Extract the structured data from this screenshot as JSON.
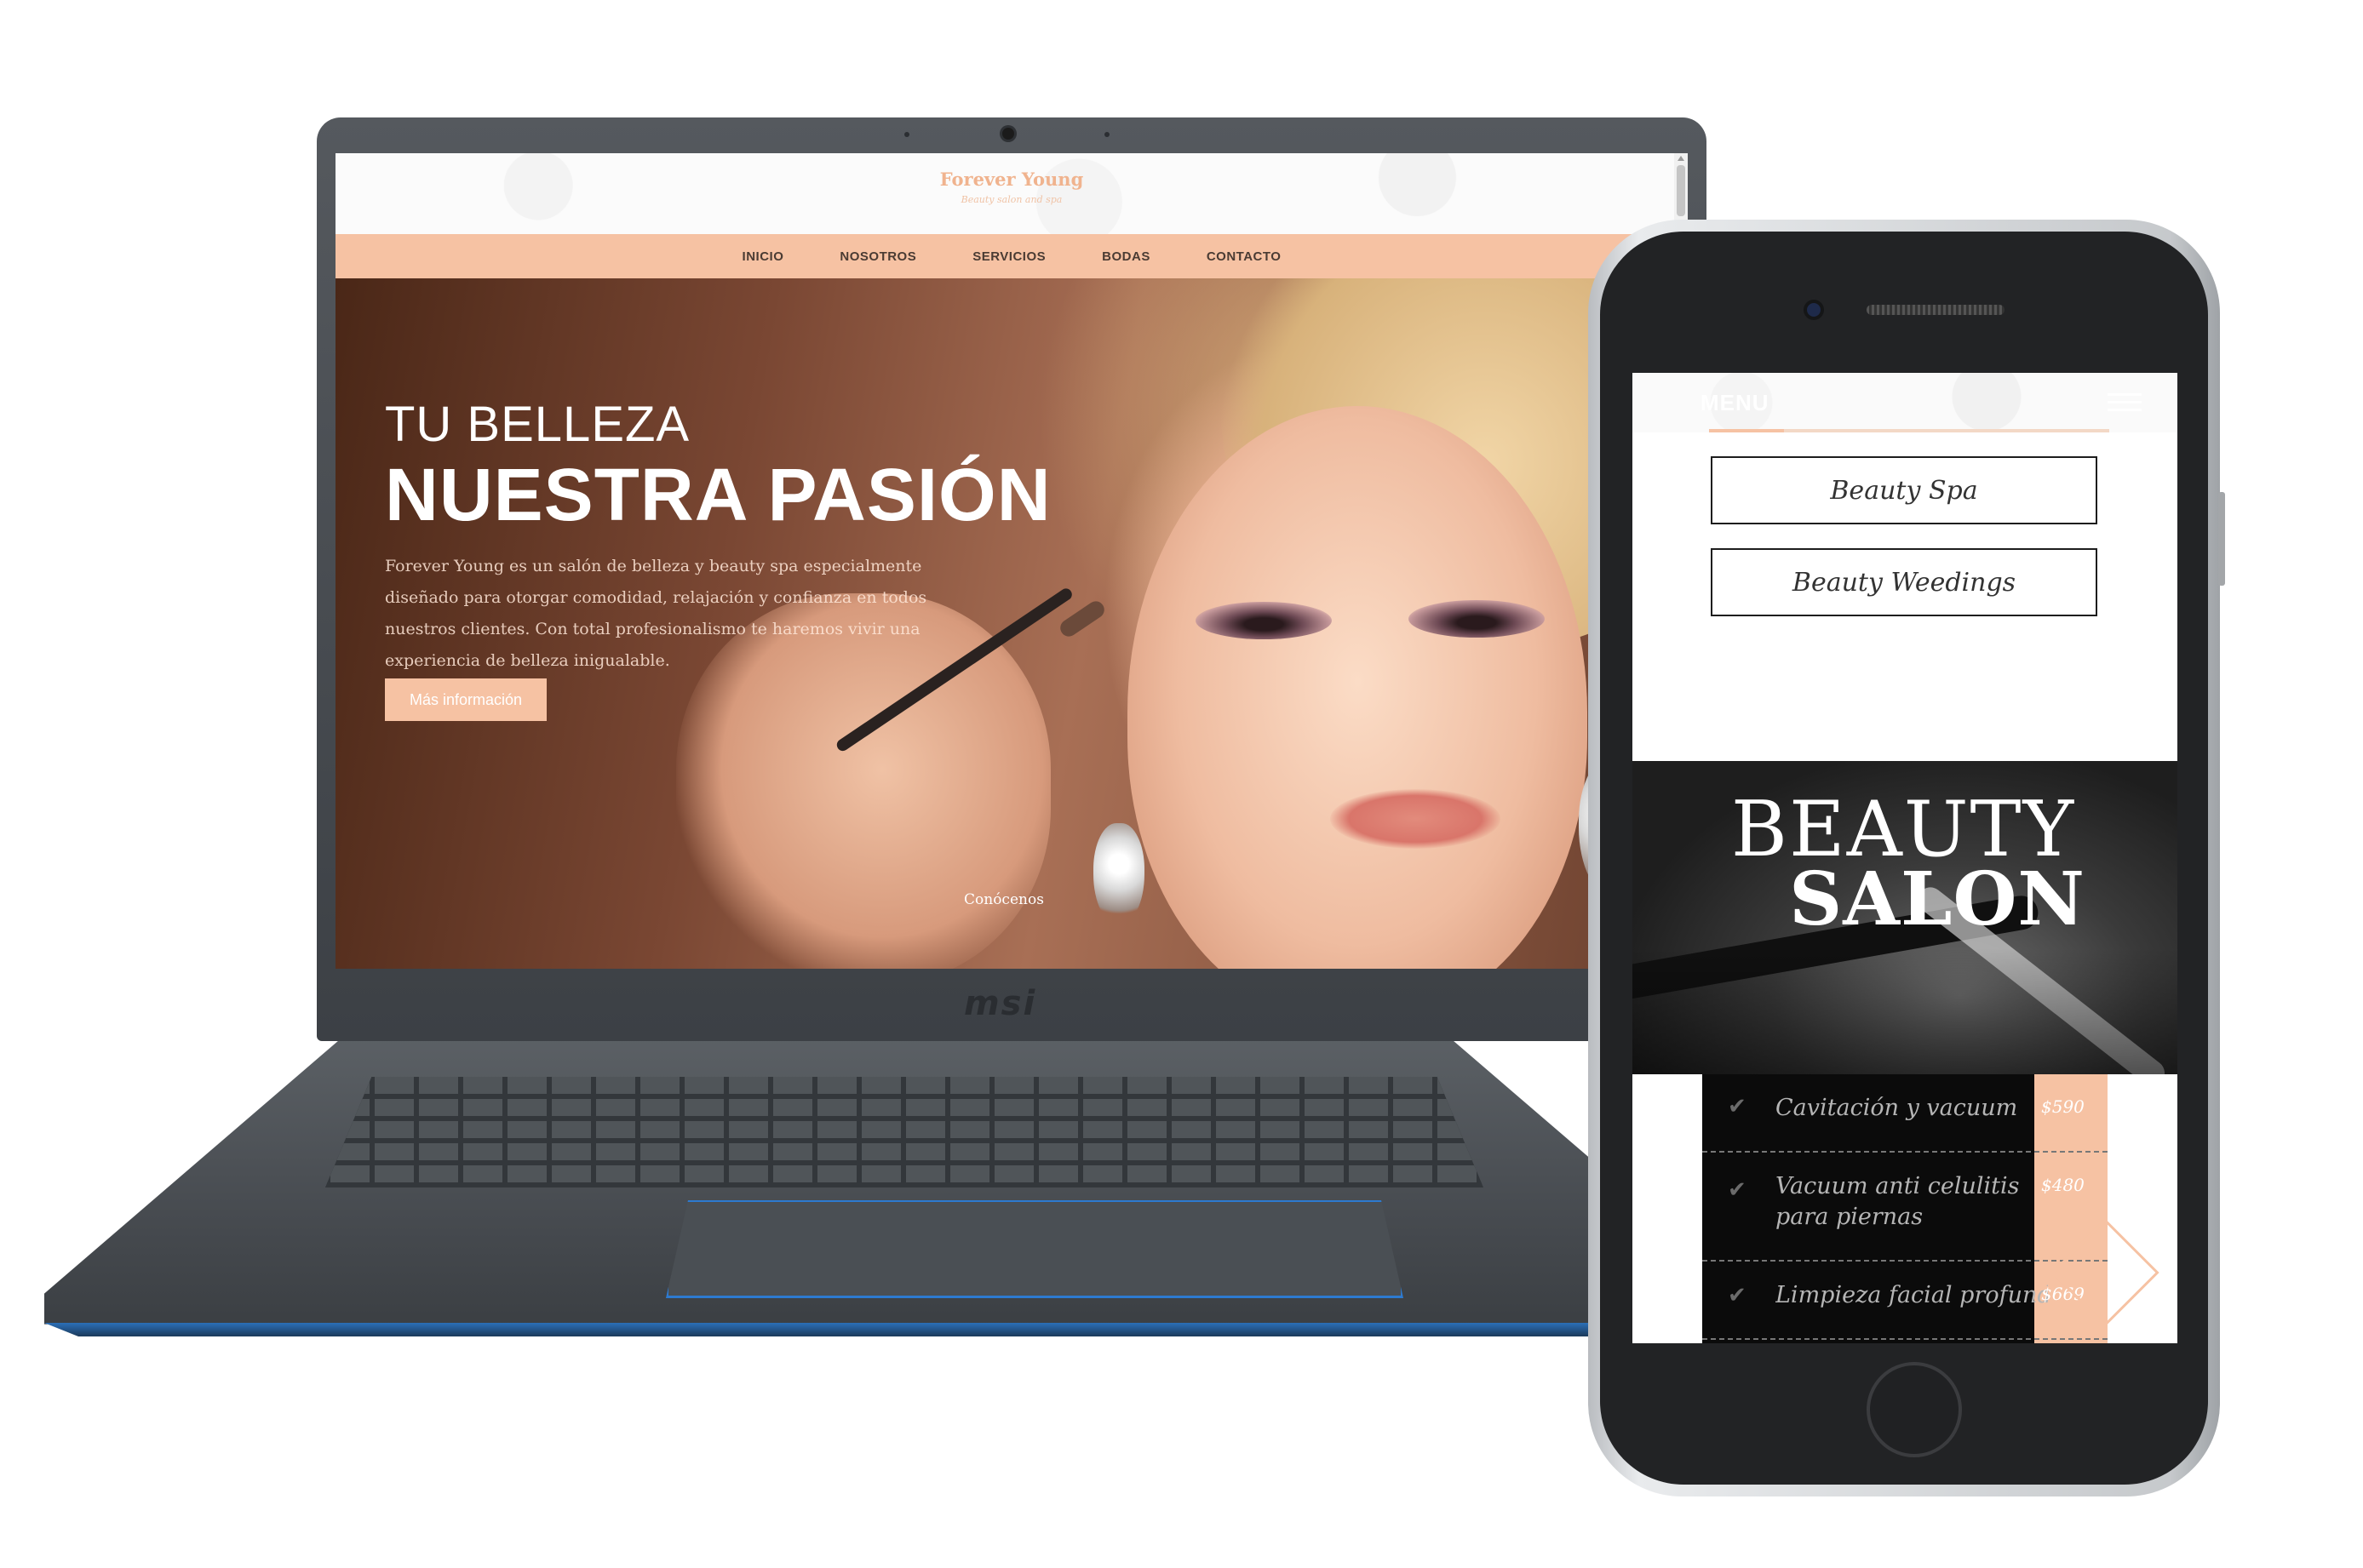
{
  "laptop": {
    "brand": "msi",
    "site": {
      "logo": "Forever Young",
      "tagline": "Beauty salon and spa",
      "nav": [
        "INICIO",
        "NOSOTROS",
        "SERVICIOS",
        "BODAS",
        "CONTACTO"
      ],
      "hero": {
        "line1": "TU BELLEZA",
        "line2": "NUESTRA PASIÓN",
        "description": "Forever Young es un salón de belleza y beauty spa especialmente diseñado para otorgar comodidad, relajación y confianza en todos nuestros clientes. Con total profesionalismo te haremos vivir una experiencia de belleza inigualable.",
        "button": "Más información",
        "link": "Conócenos"
      }
    }
  },
  "phone": {
    "header": {
      "menu_label": "MENU"
    },
    "buttons": [
      "Beauty Spa",
      "Beauty Weedings"
    ],
    "banner": {
      "line1": "BEAUTY",
      "line2": "SALON"
    },
    "services": [
      {
        "name": "Cavitación y vacuum",
        "price": "$590"
      },
      {
        "name": "Vacuum anti celulitis para piernas",
        "price": "$480"
      },
      {
        "name": "Limpieza facial profunda",
        "price": "$669"
      }
    ]
  },
  "colors": {
    "accent": "#f6c2a3",
    "nav_text": "#4a3b33",
    "dark": "#0b0b0b"
  }
}
